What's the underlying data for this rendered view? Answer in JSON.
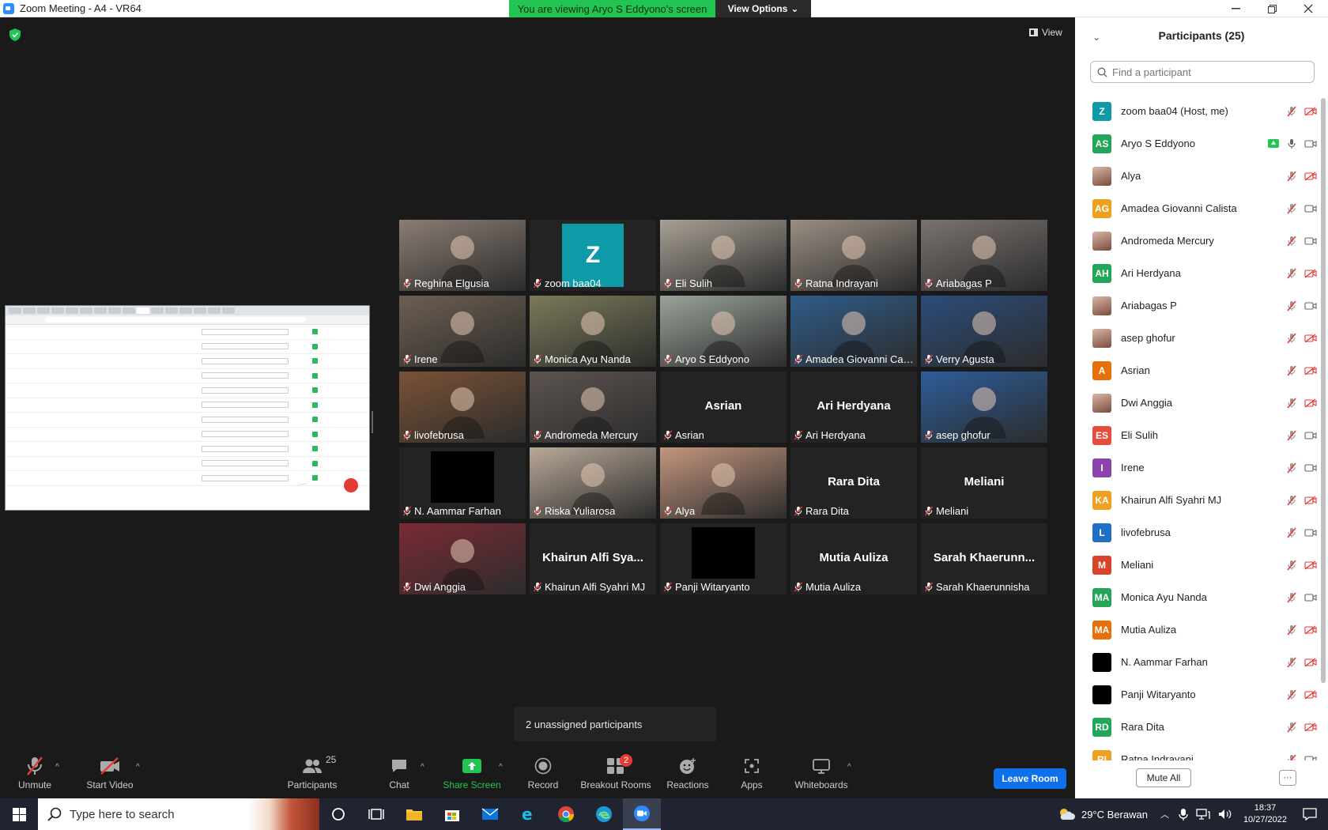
{
  "window": {
    "title": "Zoom Meeting - A4 - VR64",
    "viewing_banner": "You are viewing Aryo S Eddyono's screen",
    "view_options": "View Options",
    "view_label": "View"
  },
  "tiles": [
    {
      "name": "Reghina Elgusia",
      "kind": "photo",
      "tone": "#8a7d74"
    },
    {
      "name": "zoom baa04",
      "kind": "zavatar",
      "letter": "Z"
    },
    {
      "name": "Eli Sulih",
      "kind": "photo",
      "tone": "#a8a095"
    },
    {
      "name": "Ratna Indrayani",
      "kind": "photo",
      "tone": "#9a8e84"
    },
    {
      "name": "Ariabagas P",
      "kind": "photo",
      "tone": "#7a7370"
    },
    {
      "name": "Irene",
      "kind": "photo",
      "tone": "#6d5f52"
    },
    {
      "name": "Monica Ayu Nanda",
      "kind": "photo",
      "tone": "#7b7a5a"
    },
    {
      "name": "Aryo S Eddyono",
      "kind": "photo",
      "tone": "#9aa39a",
      "active": true
    },
    {
      "name": "Amadea Giovanni Cal...",
      "kind": "photo",
      "tone": "#2f5c8a"
    },
    {
      "name": "Verry Agusta",
      "kind": "photo",
      "tone": "#2c4c7a"
    },
    {
      "name": "livofebrusa",
      "kind": "photo",
      "tone": "#7a5236"
    },
    {
      "name": "Andromeda Mercury",
      "kind": "photo",
      "tone": "#5c5450"
    },
    {
      "name": "Asrian",
      "kind": "text",
      "big": "Asrian"
    },
    {
      "name": "Ari Herdyana",
      "kind": "text",
      "big": "Ari Herdyana"
    },
    {
      "name": "asep ghofur",
      "kind": "photo",
      "tone": "#2d5d9a"
    },
    {
      "name": "N. Aammar Farhan",
      "kind": "black"
    },
    {
      "name": "Riska Yuliarosa",
      "kind": "photo",
      "tone": "#b9a898"
    },
    {
      "name": "Alya",
      "kind": "photo",
      "tone": "#c4967e"
    },
    {
      "name": "Rara Dita",
      "kind": "text",
      "big": "Rara Dita"
    },
    {
      "name": "Meliani",
      "kind": "text",
      "big": "Meliani"
    },
    {
      "name": "Dwi Anggia",
      "kind": "photo",
      "tone": "#7a2a35"
    },
    {
      "name": "Khairun Alfi Syahri MJ",
      "kind": "text",
      "big": "Khairun  Alfi  Sya..."
    },
    {
      "name": "Panji Witaryanto",
      "kind": "black"
    },
    {
      "name": "Mutia Auliza",
      "kind": "text",
      "big": "Mutia Auliza"
    },
    {
      "name": "Sarah Khaerunnisha",
      "kind": "text",
      "big": "Sarah  Khaerunn..."
    }
  ],
  "tooltip": "2 unassigned participants",
  "toolbar": {
    "unmute": "Unmute",
    "start_video": "Start Video",
    "participants": "Participants",
    "participants_count": "25",
    "chat": "Chat",
    "share_screen": "Share Screen",
    "record": "Record",
    "breakout_rooms": "Breakout Rooms",
    "breakout_badge": "2",
    "reactions": "Reactions",
    "apps": "Apps",
    "whiteboards": "Whiteboards",
    "leave_room": "Leave Room"
  },
  "panel": {
    "title": "Participants (25)",
    "search_placeholder": "Find a participant",
    "mute_all": "Mute All",
    "more": "···",
    "participants": [
      {
        "name": "zoom baa04 (Host, me)",
        "initials": "Z",
        "color": "#0e9aa7",
        "video": false
      },
      {
        "name": "Aryo S Eddyono",
        "initials": "AS",
        "color": "#23a65a",
        "video": true,
        "mic_on": true,
        "sharing": true
      },
      {
        "name": "Alya",
        "initials": "",
        "photo": true,
        "video": false
      },
      {
        "name": "Amadea Giovanni Calista",
        "initials": "AG",
        "color": "#f0a020",
        "video": true
      },
      {
        "name": "Andromeda Mercury",
        "initials": "",
        "photo": true,
        "video": true
      },
      {
        "name": "Ari Herdyana",
        "initials": "AH",
        "color": "#23a65a",
        "video": false
      },
      {
        "name": "Ariabagas P",
        "initials": "",
        "photo": true,
        "video": true
      },
      {
        "name": "asep ghofur",
        "initials": "",
        "photo": true,
        "video": false
      },
      {
        "name": "Asrian",
        "initials": "A",
        "color": "#e8700a",
        "video": false
      },
      {
        "name": "Dwi Anggia",
        "initials": "",
        "photo": true,
        "video": false
      },
      {
        "name": "Eli Sulih",
        "initials": "ES",
        "color": "#e74c3c",
        "video": true
      },
      {
        "name": "Irene",
        "initials": "I",
        "color": "#8e44ad",
        "video": true
      },
      {
        "name": "Khairun Alfi Syahri MJ",
        "initials": "KA",
        "color": "#f0a020",
        "video": false
      },
      {
        "name": "livofebrusa",
        "initials": "L",
        "color": "#1f6fc5",
        "video": true
      },
      {
        "name": "Meliani",
        "initials": "M",
        "color": "#d9432a",
        "video": false
      },
      {
        "name": "Monica Ayu Nanda",
        "initials": "MA",
        "color": "#23a65a",
        "video": true
      },
      {
        "name": "Mutia Auliza",
        "initials": "MA",
        "color": "#e8700a",
        "video": false
      },
      {
        "name": "N. Aammar Farhan",
        "initials": "",
        "color": "#000000",
        "video": false
      },
      {
        "name": "Panji Witaryanto",
        "initials": "",
        "color": "#000000",
        "video": false
      },
      {
        "name": "Rara Dita",
        "initials": "RD",
        "color": "#23a65a",
        "video": false
      },
      {
        "name": "Ratna Indrayani",
        "initials": "RI",
        "color": "#f0a020",
        "video": true
      }
    ]
  },
  "taskbar": {
    "search_placeholder": "Type here to search",
    "weather": "29°C  Berawan",
    "time": "18:37",
    "date": "10/27/2022"
  },
  "colors": {
    "accent": "#0e71eb",
    "banner_green": "#23c552",
    "mute_red": "#e53935"
  }
}
